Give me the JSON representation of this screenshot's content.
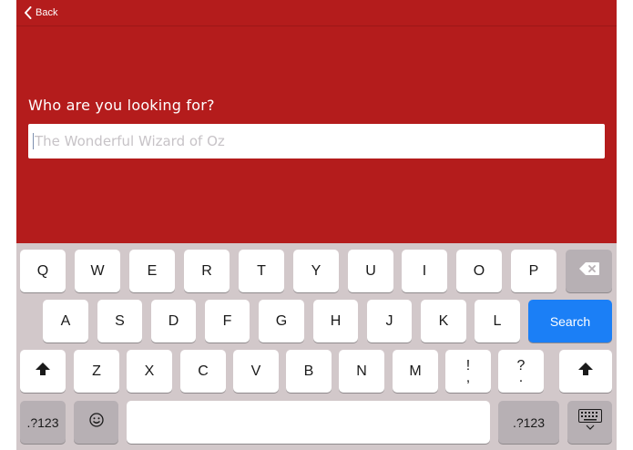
{
  "nav": {
    "back_label": "Back"
  },
  "main": {
    "prompt": "Who are you looking for?",
    "search": {
      "placeholder": "The Wonderful Wizard of Oz",
      "value": ""
    }
  },
  "keyboard": {
    "row1": [
      "Q",
      "W",
      "E",
      "R",
      "T",
      "Y",
      "U",
      "I",
      "O",
      "P"
    ],
    "row2": [
      "A",
      "S",
      "D",
      "F",
      "G",
      "H",
      "J",
      "K",
      "L"
    ],
    "search_label": "Search",
    "row3": [
      "Z",
      "X",
      "C",
      "V",
      "B",
      "N",
      "M"
    ],
    "exclaim_top": "!",
    "exclaim_bottom": ",",
    "question_top": "?",
    "question_bottom": ".",
    "numbers_label": ".?123",
    "numbers_label_right": ".?123"
  },
  "colors": {
    "background": "#b41c1c",
    "keyboard_bg": "#d2c8ca",
    "search_key": "#1b7ff6"
  },
  "icons": [
    "chevron-left-icon",
    "backspace-icon",
    "shift-icon",
    "emoji-icon",
    "keyboard-dismiss-icon"
  ]
}
